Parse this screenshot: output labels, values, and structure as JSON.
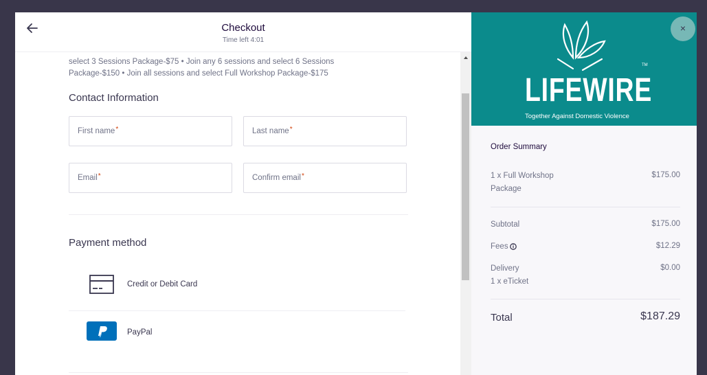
{
  "header": {
    "title": "Checkout",
    "timer": "Time left 4:01"
  },
  "description": {
    "line1": "select 3 Sessions Package-$75 • Join any 6 sessions and select 6 Sessions",
    "line2": "Package-$150 • Join all sessions and select Full Workshop Package-$175"
  },
  "contact": {
    "title": "Contact Information",
    "first_name": "First name",
    "last_name": "Last name",
    "email": "Email",
    "confirm_email": "Confirm email",
    "required_mark": "*"
  },
  "payment": {
    "title": "Payment method",
    "methods": [
      {
        "label": "Credit or Debit Card",
        "icon": "credit-card-icon"
      },
      {
        "label": "PayPal",
        "icon": "paypal-icon"
      }
    ]
  },
  "banner": {
    "logo_text": "LIFEWIRE",
    "tm": "TM",
    "tagline": "Together Against Domestic Violence",
    "background": "#0b8b8c"
  },
  "close": {
    "label": "×"
  },
  "order_summary": {
    "title": "Order Summary",
    "item": {
      "line1": "1 x Full Workshop",
      "line2": "Package",
      "price": "$175.00"
    },
    "subtotal": {
      "label": "Subtotal",
      "value": "$175.00"
    },
    "fees": {
      "label": "Fees",
      "value": "$12.29"
    },
    "delivery": {
      "label": "Delivery",
      "sub": "1 x eTicket",
      "value": "$0.00"
    },
    "total": {
      "label": "Total",
      "value": "$187.29"
    }
  },
  "colors": {
    "overlay": "#39364a",
    "required": "#d1410c",
    "paypal": "#0070ba"
  }
}
